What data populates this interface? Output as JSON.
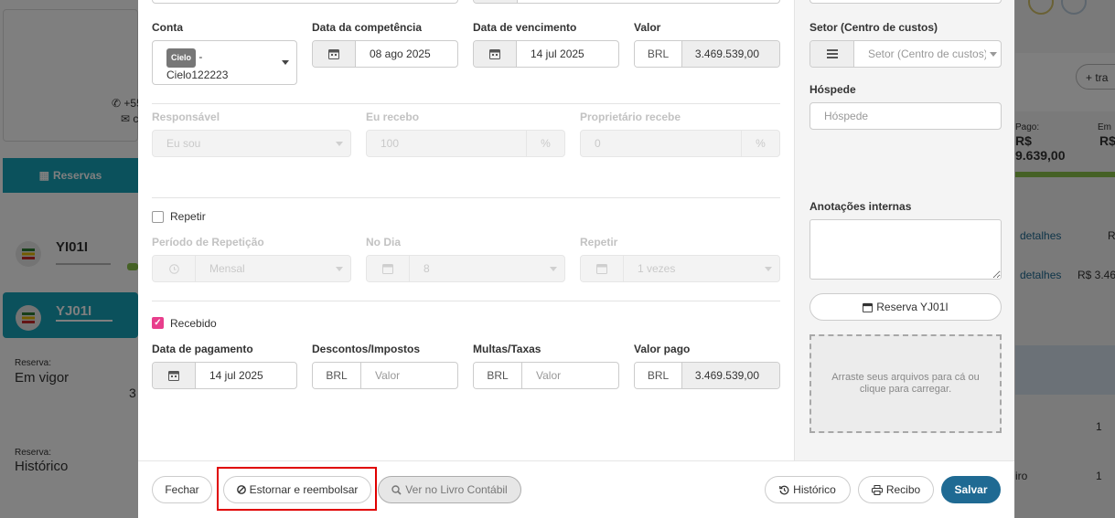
{
  "background": {
    "phone_fragment": "+55",
    "email_fragment": "c",
    "reservas_label": "Reservas",
    "rooms": [
      "YI01I",
      "YJ01I"
    ],
    "reserva_label_1": "Reserva:",
    "reserva_value_1": "Em vigor",
    "reserva_num_fragment": "3",
    "reserva_label_2": "Reserva:",
    "reserva_value_2": "Histórico",
    "right_add_label": "tra",
    "right_pago_label": "Pago:",
    "right_pago_value_a": "R$",
    "right_pago_value_b": "9.639,00",
    "right_em_label": "Em",
    "right_em_value": "R$",
    "right_link_1": "detalhes",
    "right_col_1": "R",
    "right_link_2": "detalhes",
    "right_col_2": "R$ 3.46",
    "right_num_1": "1",
    "right_ro": "iro",
    "right_num_2": "1"
  },
  "form": {
    "conta_label": "Conta",
    "conta_badge": "Cielo",
    "conta_text_1": "-",
    "conta_text_2": "Cielo122223",
    "competencia_label": "Data da competência",
    "competencia_value": "08 ago 2025",
    "vencimento_label": "Data de vencimento",
    "vencimento_value": "14 jul 2025",
    "valor_label": "Valor",
    "valor_currency": "BRL",
    "valor_value": "3.469.539,00",
    "responsavel_label": "Responsável",
    "responsavel_value": "Eu sou",
    "eu_recebo_label": "Eu recebo",
    "eu_recebo_value": "100",
    "eu_recebo_suffix": "%",
    "proprietario_label": "Proprietário recebe",
    "proprietario_value": "0",
    "proprietario_suffix": "%",
    "repetir_label": "Repetir",
    "repetir_checked": false,
    "periodo_label": "Período de Repetição",
    "periodo_value": "Mensal",
    "no_dia_label": "No Dia",
    "no_dia_value": "8",
    "repetir2_label": "Repetir",
    "repetir2_value": "1 vezes",
    "recebido_label": "Recebido",
    "recebido_checked": true,
    "pagamento_label": "Data de pagamento",
    "pagamento_value": "14 jul 2025",
    "descontos_label": "Descontos/Impostos",
    "descontos_currency": "BRL",
    "descontos_placeholder": "Valor",
    "multas_label": "Multas/Taxas",
    "multas_currency": "BRL",
    "multas_placeholder": "Valor",
    "valor_pago_label": "Valor pago",
    "valor_pago_currency": "BRL",
    "valor_pago_value": "3.469.539,00"
  },
  "side": {
    "setor_label": "Setor (Centro de custos)",
    "setor_placeholder": "Setor (Centro de custos)",
    "hospede_label": "Hóspede",
    "hospede_placeholder": "Hóspede",
    "anotacoes_label": "Anotações internas",
    "reserva_button": "Reserva YJ01I",
    "dropzone_text": "Arraste seus arquivos para cá ou clique para carregar."
  },
  "footer": {
    "fechar": "Fechar",
    "estornar": "Estornar e reembolsar",
    "livro": "Ver no Livro Contábil",
    "historico": "Histórico",
    "recibo": "Recibo",
    "salvar": "Salvar"
  },
  "colors": {
    "primary": "#1f6a93",
    "checkbox": "#e83e8c",
    "highlight": "#e00000",
    "teal": "#17a2b8"
  }
}
